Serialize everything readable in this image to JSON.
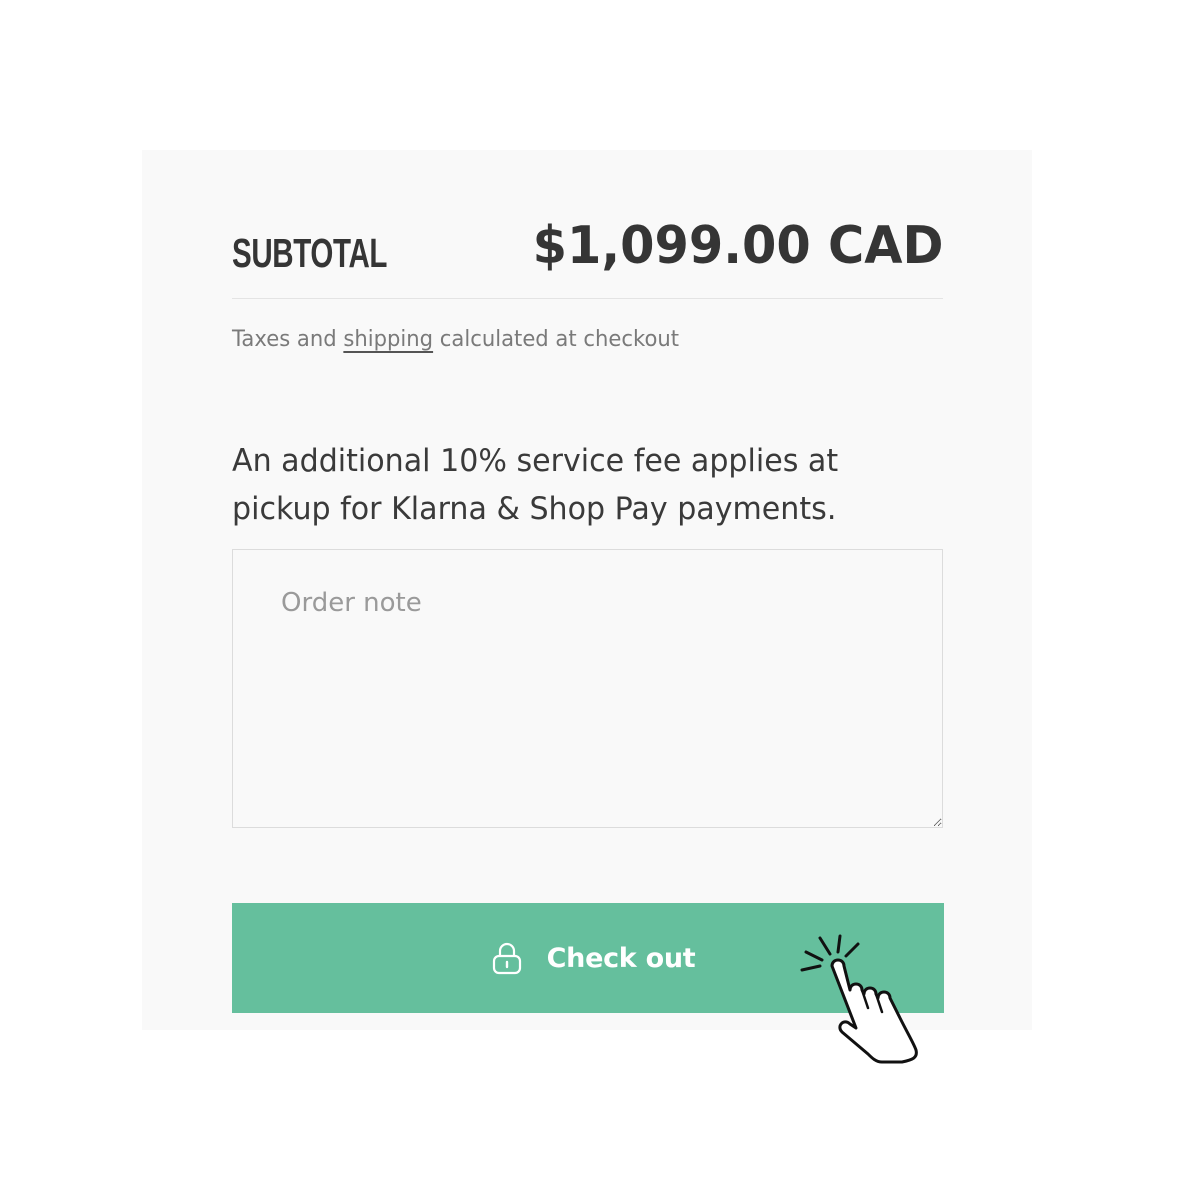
{
  "cart_summary": {
    "subtotal_label": "SUBTOTAL",
    "subtotal_amount": "$1,099.00 CAD",
    "tax_note_prefix": "Taxes and ",
    "tax_note_link": "shipping",
    "tax_note_suffix": " calculated at checkout",
    "service_fee_note": "An additional 10% service fee applies at pickup for Klarna & Shop Pay payments.",
    "order_note_placeholder": "Order note",
    "checkout_label": "Check out"
  },
  "colors": {
    "panel_background": "#f9f9f9",
    "button_accent": "#65bf9d",
    "text_dark": "#353535",
    "text_muted": "#7a7a7a"
  },
  "icons": {
    "checkout_icon": "lock-icon",
    "cursor_icon": "hand-pointer-click-icon"
  }
}
